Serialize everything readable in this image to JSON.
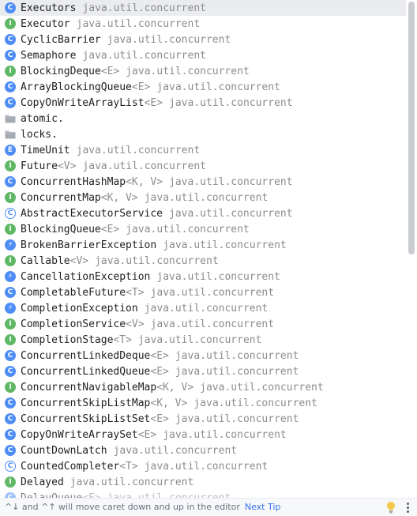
{
  "items": [
    {
      "kind": "class",
      "letter": "C",
      "name": "Executors",
      "generic": "",
      "package": "java.util.concurrent"
    },
    {
      "kind": "interface",
      "letter": "I",
      "name": "Executor",
      "generic": "",
      "package": "java.util.concurrent"
    },
    {
      "kind": "class",
      "letter": "C",
      "name": "CyclicBarrier",
      "generic": "",
      "package": "java.util.concurrent"
    },
    {
      "kind": "class",
      "letter": "C",
      "name": "Semaphore",
      "generic": "",
      "package": "java.util.concurrent"
    },
    {
      "kind": "interface",
      "letter": "I",
      "name": "BlockingDeque",
      "generic": "<E>",
      "package": "java.util.concurrent"
    },
    {
      "kind": "class",
      "letter": "C",
      "name": "ArrayBlockingQueue",
      "generic": "<E>",
      "package": "java.util.concurrent"
    },
    {
      "kind": "class",
      "letter": "C",
      "name": "CopyOnWriteArrayList",
      "generic": "<E>",
      "package": "java.util.concurrent"
    },
    {
      "kind": "package",
      "letter": "",
      "name": "atomic.",
      "generic": "",
      "package": ""
    },
    {
      "kind": "package",
      "letter": "",
      "name": "locks.",
      "generic": "",
      "package": ""
    },
    {
      "kind": "enum",
      "letter": "E",
      "name": "TimeUnit",
      "generic": "",
      "package": "java.util.concurrent"
    },
    {
      "kind": "interface",
      "letter": "I",
      "name": "Future",
      "generic": "<V>",
      "package": "java.util.concurrent"
    },
    {
      "kind": "class",
      "letter": "C",
      "name": "ConcurrentHashMap",
      "generic": "<K, V>",
      "package": "java.util.concurrent"
    },
    {
      "kind": "interface",
      "letter": "I",
      "name": "ConcurrentMap",
      "generic": "<K, V>",
      "package": "java.util.concurrent"
    },
    {
      "kind": "abstract",
      "letter": "C",
      "name": "AbstractExecutorService",
      "generic": "",
      "package": "java.util.concurrent"
    },
    {
      "kind": "interface",
      "letter": "I",
      "name": "BlockingQueue",
      "generic": "<E>",
      "package": "java.util.concurrent"
    },
    {
      "kind": "exception",
      "letter": "⚡",
      "name": "BrokenBarrierException",
      "generic": "",
      "package": "java.util.concurrent"
    },
    {
      "kind": "interface",
      "letter": "I",
      "name": "Callable",
      "generic": "<V>",
      "package": "java.util.concurrent"
    },
    {
      "kind": "exception",
      "letter": "⚡",
      "name": "CancellationException",
      "generic": "",
      "package": "java.util.concurrent"
    },
    {
      "kind": "class",
      "letter": "C",
      "name": "CompletableFuture",
      "generic": "<T>",
      "package": "java.util.concurrent"
    },
    {
      "kind": "exception",
      "letter": "⚡",
      "name": "CompletionException",
      "generic": "",
      "package": "java.util.concurrent"
    },
    {
      "kind": "interface",
      "letter": "I",
      "name": "CompletionService",
      "generic": "<V>",
      "package": "java.util.concurrent"
    },
    {
      "kind": "interface",
      "letter": "I",
      "name": "CompletionStage",
      "generic": "<T>",
      "package": "java.util.concurrent"
    },
    {
      "kind": "class",
      "letter": "C",
      "name": "ConcurrentLinkedDeque",
      "generic": "<E>",
      "package": "java.util.concurrent"
    },
    {
      "kind": "class",
      "letter": "C",
      "name": "ConcurrentLinkedQueue",
      "generic": "<E>",
      "package": "java.util.concurrent"
    },
    {
      "kind": "interface",
      "letter": "I",
      "name": "ConcurrentNavigableMap",
      "generic": "<K, V>",
      "package": "java.util.concurrent"
    },
    {
      "kind": "class",
      "letter": "C",
      "name": "ConcurrentSkipListMap",
      "generic": "<K, V>",
      "package": "java.util.concurrent"
    },
    {
      "kind": "class",
      "letter": "C",
      "name": "ConcurrentSkipListSet",
      "generic": "<E>",
      "package": "java.util.concurrent"
    },
    {
      "kind": "class",
      "letter": "C",
      "name": "CopyOnWriteArraySet",
      "generic": "<E>",
      "package": "java.util.concurrent"
    },
    {
      "kind": "class",
      "letter": "C",
      "name": "CountDownLatch",
      "generic": "",
      "package": "java.util.concurrent"
    },
    {
      "kind": "abstract",
      "letter": "C",
      "name": "CountedCompleter",
      "generic": "<T>",
      "package": "java.util.concurrent"
    },
    {
      "kind": "interface",
      "letter": "I",
      "name": "Delayed",
      "generic": "",
      "package": "java.util.concurrent"
    },
    {
      "kind": "class",
      "letter": "C",
      "name": "DelayQueue",
      "generic": "<E>",
      "package": "java.util.concurrent"
    }
  ],
  "selected_index": 0,
  "footer": {
    "tip": "^↓ and ^↑ will move caret down and up in the editor",
    "next_tip": "Next Tip"
  },
  "colors": {
    "class": "#4e8df6",
    "interface": "#5fb865",
    "selection": "#ebecf0",
    "link": "#3574f0"
  },
  "icons": {
    "package": "folder-package-icon",
    "bulb": "lightbulb-icon",
    "more": "more-vertical-icon"
  }
}
